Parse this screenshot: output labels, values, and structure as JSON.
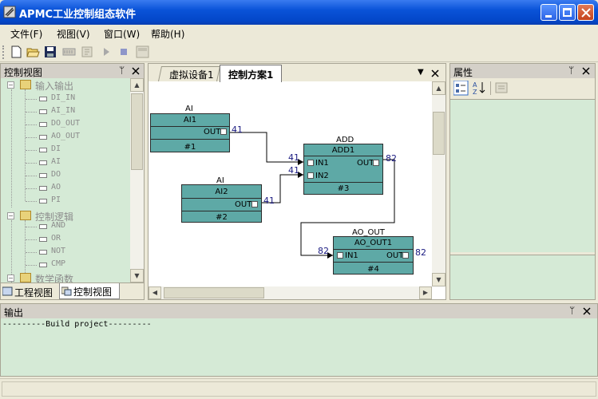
{
  "window": {
    "title": "APMC工业控制组态软件"
  },
  "menu": [
    "文件(F)",
    "视图(V)",
    "窗口(W)",
    "帮助(H)"
  ],
  "left_panel": {
    "title": "控制视图",
    "tree": {
      "group1": {
        "label": "输入输出",
        "items": [
          "DI_IN",
          "AI_IN",
          "DO_OUT",
          "AO_OUT",
          "DI",
          "AI",
          "DO",
          "AO",
          "PI"
        ]
      },
      "group2": {
        "label": "控制逻辑",
        "items": [
          "AND",
          "OR",
          "NOT",
          "CMP"
        ]
      },
      "group3": {
        "label": "数学函数"
      }
    },
    "tabs": [
      "工程视图",
      "控制视图"
    ]
  },
  "center": {
    "tabs": [
      "虚拟设备1",
      "控制方案1"
    ],
    "blocks": {
      "ai1": {
        "type": "AI",
        "name": "AI1",
        "out": "OUT",
        "num": "#1"
      },
      "ai2": {
        "type": "AI",
        "name": "AI2",
        "out": "OUT",
        "num": "#2"
      },
      "add1": {
        "type": "ADD",
        "name": "ADD1",
        "in1": "IN1",
        "in2": "IN2",
        "out": "OUT",
        "num": "#3"
      },
      "ao1": {
        "type": "AO_OUT",
        "name": "AO_OUT1",
        "in1": "IN1",
        "out": "OUT",
        "num": "#4"
      }
    },
    "wire_labels": {
      "ai1_out": "41",
      "add_in1": "41",
      "add_in2": "41",
      "ai2_out": "41",
      "add_out": "82",
      "ao_in": "82",
      "ao_out": "82"
    }
  },
  "right_panel": {
    "title": "属性"
  },
  "output_panel": {
    "title": "输出",
    "text": "---------Build project---------"
  }
}
